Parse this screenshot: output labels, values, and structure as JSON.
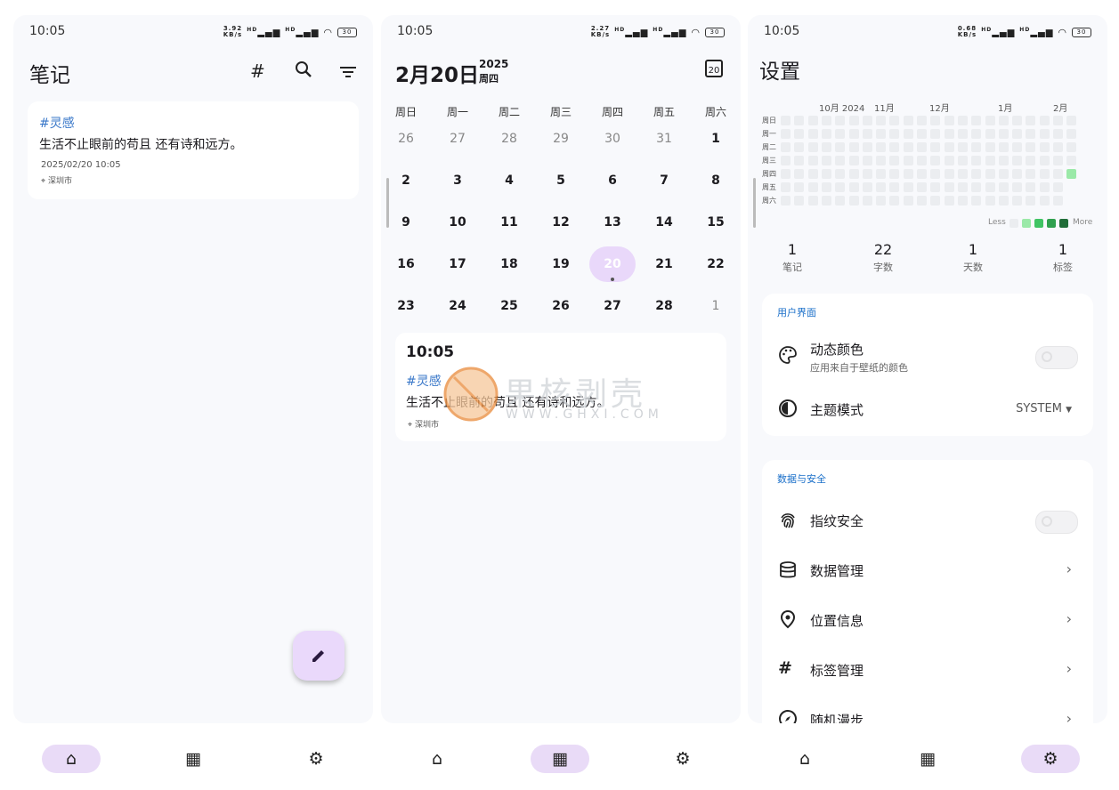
{
  "status": [
    {
      "time": "10:05",
      "speed": "3.92",
      "speed_unit": "KB/s",
      "sig1": "HD",
      "sig2": "HD",
      "battery": "30"
    },
    {
      "time": "10:05",
      "speed": "2.27",
      "speed_unit": "KB/s",
      "sig1": "HD",
      "sig2": "HD",
      "battery": "30"
    },
    {
      "time": "10:05",
      "speed": "0.68",
      "speed_unit": "KB/s",
      "sig1": "HD",
      "sig2": "HD",
      "battery": "30"
    }
  ],
  "notes": {
    "title": "笔记",
    "card": {
      "tag": "#灵感",
      "text": "生活不止眼前的苟且 还有诗和远方。",
      "datetime": "2025/02/20 10:05",
      "location": "深圳市"
    },
    "fab_icon": "pencil-icon"
  },
  "calendar": {
    "date": "2月20日",
    "year": "2025",
    "weekday": "周四",
    "today_badge": "20",
    "weekdays": [
      "周日",
      "周一",
      "周二",
      "周三",
      "周四",
      "周五",
      "周六"
    ],
    "weeks": [
      [
        "26",
        "27",
        "28",
        "29",
        "30",
        "31",
        "1"
      ],
      [
        "2",
        "3",
        "4",
        "5",
        "6",
        "7",
        "8"
      ],
      [
        "9",
        "10",
        "11",
        "12",
        "13",
        "14",
        "15"
      ],
      [
        "16",
        "17",
        "18",
        "19",
        "20",
        "21",
        "22"
      ],
      [
        "23",
        "24",
        "25",
        "26",
        "27",
        "28",
        "1"
      ]
    ],
    "entry": {
      "time": "10:05",
      "tag": "#灵感",
      "text": "生活不止眼前的苟且 还有诗和远方。",
      "location": "深圳市"
    },
    "watermark": {
      "brand": "果核剥壳",
      "url": "WWW.GHXI.COM"
    }
  },
  "settings": {
    "title": "设置",
    "heatmap": {
      "months": [
        "10月 2024",
        "11月",
        "12月",
        "1月",
        "2月"
      ],
      "days": [
        "周日",
        "周一",
        "周二",
        "周三",
        "周四",
        "周五",
        "周六"
      ],
      "legend_less": "Less",
      "legend_more": "More",
      "active_count": 1
    },
    "stats": [
      {
        "value": "1",
        "label": "笔记"
      },
      {
        "value": "22",
        "label": "字数"
      },
      {
        "value": "1",
        "label": "天数"
      },
      {
        "value": "1",
        "label": "标签"
      }
    ],
    "ui_section": {
      "header": "用户界面",
      "dynamic_color": {
        "title": "动态颜色",
        "subtitle": "应用来自于壁纸的颜色"
      },
      "theme": {
        "title": "主题模式",
        "value": "SYSTEM"
      }
    },
    "data_section": {
      "header": "数据与安全",
      "items": [
        "指纹安全",
        "数据管理",
        "位置信息",
        "标签管理",
        "随机漫步"
      ]
    }
  },
  "colors": {
    "accent": "#e9dbf7",
    "tag": "#3a78c9",
    "section_header": "#1a6fc9",
    "heat_active": "#9be9a8"
  }
}
